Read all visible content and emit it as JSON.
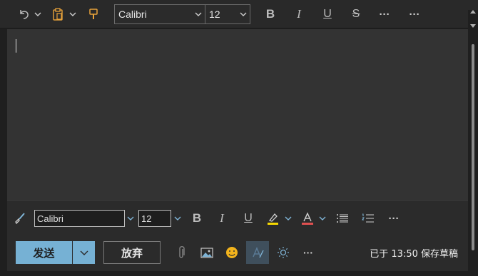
{
  "top_toolbar": {
    "font_name": "Calibri",
    "font_size": "12",
    "more_label": "···",
    "overflow_label": "···"
  },
  "editor": {
    "body_text": ""
  },
  "format_bar": {
    "font_name": "Calibri",
    "font_size": "12",
    "highlight_color": "#f5d800",
    "font_color": "#e05050",
    "more_label": "···"
  },
  "action_bar": {
    "send_label": "发送",
    "discard_label": "放弃",
    "more_label": "···",
    "saved_status": "已于 13:50 保存草稿"
  },
  "colors": {
    "accent": "#76b1d4",
    "format_painter": "#e8a23a"
  }
}
